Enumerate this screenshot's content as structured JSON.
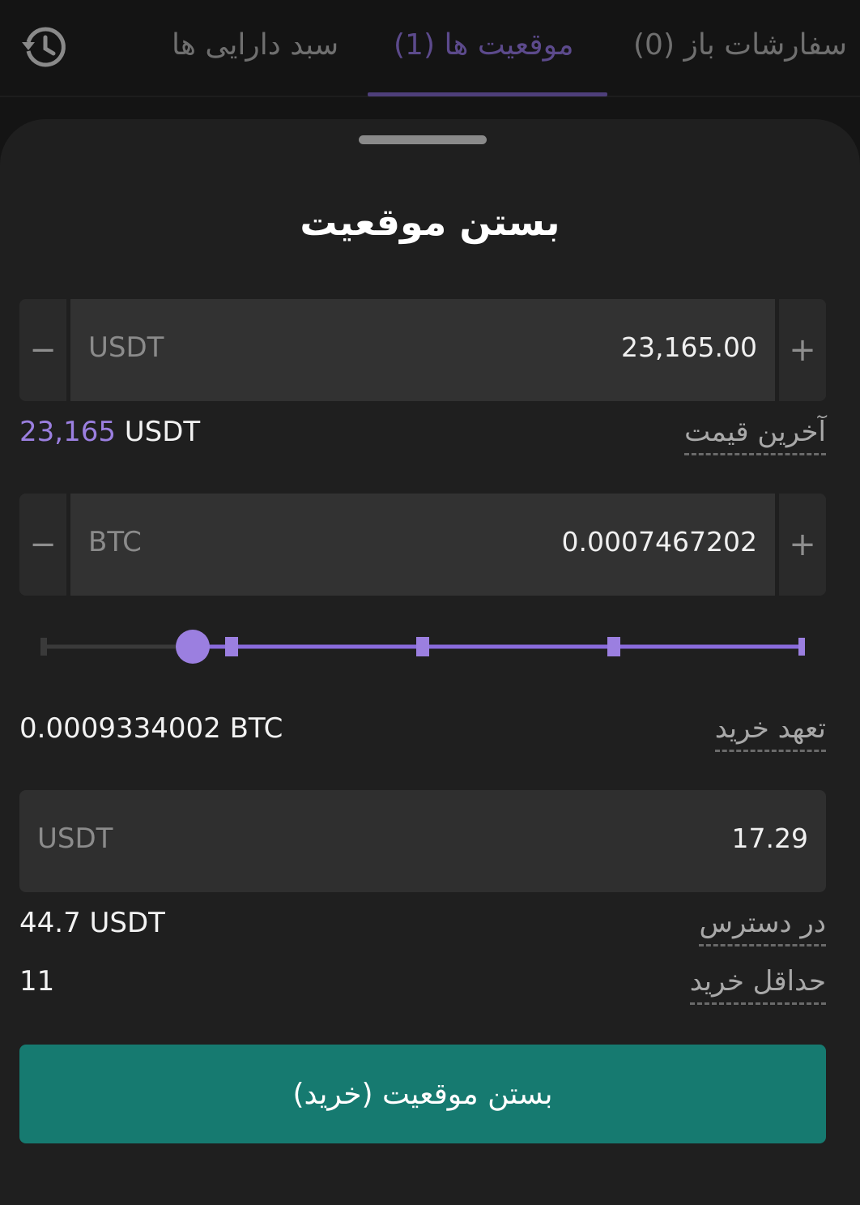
{
  "tabs": {
    "open_orders": "سفارشات باز (0)",
    "positions": "موقعیت ها (1)",
    "portfolio": "سبد دارایی ها",
    "history_icon": "history-icon"
  },
  "sheet": {
    "title": "بستن موقعیت",
    "price_input": {
      "unit": "USDT",
      "value": "23,165.00",
      "minus": "−",
      "plus": "+"
    },
    "last_price": {
      "label": "آخرین قیمت",
      "value": "23,165",
      "unit": "USDT"
    },
    "amount_input": {
      "unit": "BTC",
      "value": "0.0007467202",
      "minus": "−",
      "plus": "+"
    },
    "slider": {
      "level_percent": 80,
      "marks": [
        0,
        25,
        50,
        75,
        100
      ]
    },
    "commitment": {
      "label": "تعهد خرید",
      "value": "0.0009334002 BTC"
    },
    "total_input": {
      "unit": "USDT",
      "value": "17.29"
    },
    "available": {
      "label": "در دسترس",
      "value": "44.7 USDT"
    },
    "min_buy": {
      "label": "حداقل خرید",
      "value": "11"
    },
    "submit_label": "بستن موقعیت (خرید)"
  },
  "colors": {
    "accent": "#9b7fe0",
    "tab_active": "#5c4a8c",
    "button": "#167a70"
  }
}
